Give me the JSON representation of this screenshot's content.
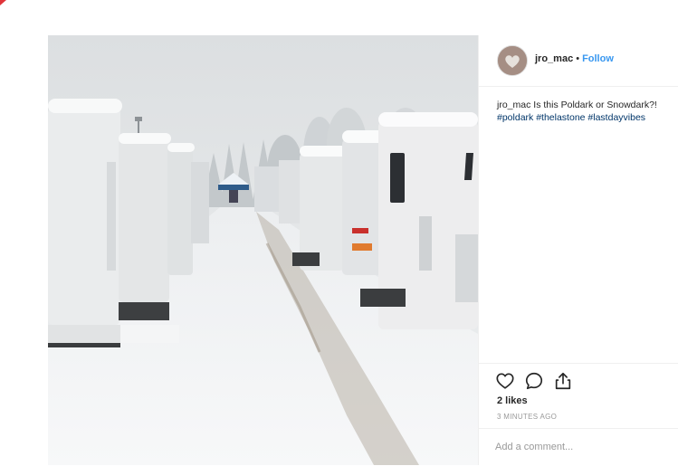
{
  "post": {
    "username": "jro_mac",
    "separator": "•",
    "follow_label": "Follow",
    "caption_user": "jro_mac",
    "caption_text": " Is this Poldark or Snowdark?!",
    "hashtags": [
      "#poldark",
      "#thelastone",
      "#lastdayvibes"
    ],
    "likes": "2 likes",
    "timestamp": "3 MINUTES AGO",
    "comment_placeholder": "Add a comment..."
  },
  "icons": {
    "like": "heart-icon",
    "comment": "comment-bubble-icon",
    "share": "share-icon"
  },
  "colors": {
    "link": "#3897f0",
    "hashtag": "#003569",
    "border": "#efefef",
    "corner_mark": "#e0343a"
  }
}
